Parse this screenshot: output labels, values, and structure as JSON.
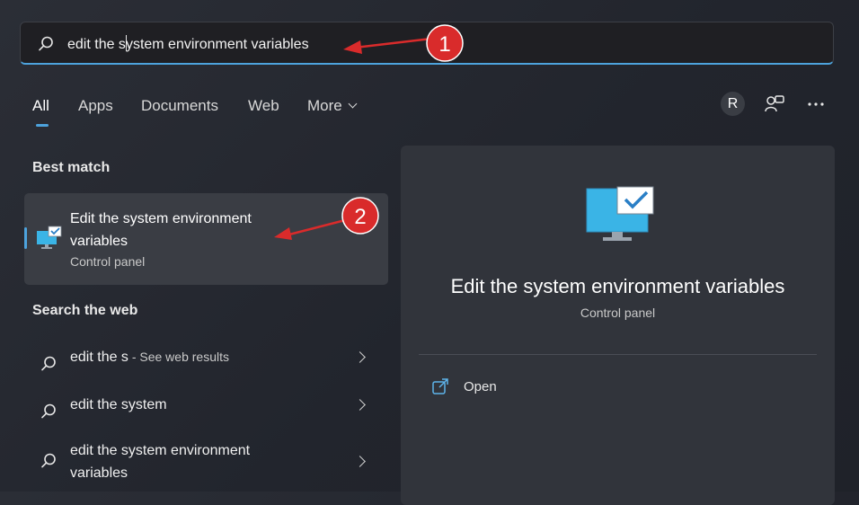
{
  "search": {
    "value_before_caret": "edit the s",
    "value_after_caret": "ystem environment variables"
  },
  "tabs": [
    {
      "label": "All",
      "active": true
    },
    {
      "label": "Apps"
    },
    {
      "label": "Documents"
    },
    {
      "label": "Web"
    },
    {
      "label": "More"
    }
  ],
  "header": {
    "avatar_letter": "R",
    "people_icon": "people-icon",
    "more_icon": "ellipsis-icon"
  },
  "best_match": {
    "heading": "Best match",
    "title": "Edit the system environment variables",
    "subtitle": "Control panel",
    "icon": "monitor-check-icon"
  },
  "search_web": {
    "heading": "Search the web",
    "items": [
      {
        "text": "edit the s",
        "suffix": " - See web results"
      },
      {
        "text": "edit the system",
        "suffix": ""
      },
      {
        "text": "edit the system environment variables",
        "suffix": ""
      }
    ]
  },
  "preview": {
    "title": "Edit the system environment variables",
    "subtitle": "Control panel",
    "open_label": "Open",
    "icon": "monitor-check-icon"
  },
  "annotations": [
    {
      "label": "1"
    },
    {
      "label": "2"
    }
  ],
  "colors": {
    "accent": "#4da3dd",
    "annotation": "#d92b2b"
  }
}
